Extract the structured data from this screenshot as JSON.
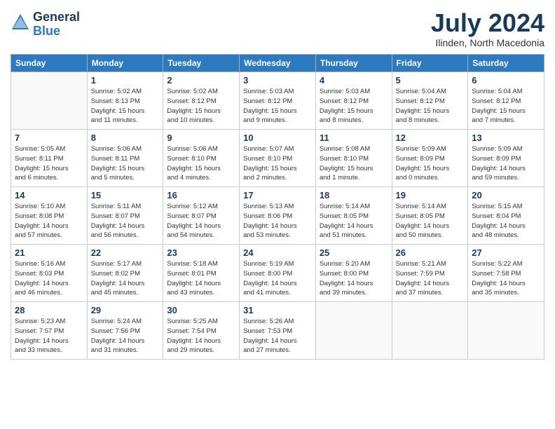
{
  "header": {
    "logo_line1": "General",
    "logo_line2": "Blue",
    "month_title": "July 2024",
    "location": "Ilinden, North Macedonia"
  },
  "weekdays": [
    "Sunday",
    "Monday",
    "Tuesday",
    "Wednesday",
    "Thursday",
    "Friday",
    "Saturday"
  ],
  "weeks": [
    [
      {
        "day": "",
        "info": ""
      },
      {
        "day": "1",
        "info": "Sunrise: 5:02 AM\nSunset: 8:13 PM\nDaylight: 15 hours\nand 11 minutes."
      },
      {
        "day": "2",
        "info": "Sunrise: 5:02 AM\nSunset: 8:12 PM\nDaylight: 15 hours\nand 10 minutes."
      },
      {
        "day": "3",
        "info": "Sunrise: 5:03 AM\nSunset: 8:12 PM\nDaylight: 15 hours\nand 9 minutes."
      },
      {
        "day": "4",
        "info": "Sunrise: 5:03 AM\nSunset: 8:12 PM\nDaylight: 15 hours\nand 8 minutes."
      },
      {
        "day": "5",
        "info": "Sunrise: 5:04 AM\nSunset: 8:12 PM\nDaylight: 15 hours\nand 8 minutes."
      },
      {
        "day": "6",
        "info": "Sunrise: 5:04 AM\nSunset: 8:12 PM\nDaylight: 15 hours\nand 7 minutes."
      }
    ],
    [
      {
        "day": "7",
        "info": "Sunrise: 5:05 AM\nSunset: 8:11 PM\nDaylight: 15 hours\nand 6 minutes."
      },
      {
        "day": "8",
        "info": "Sunrise: 5:06 AM\nSunset: 8:11 PM\nDaylight: 15 hours\nand 5 minutes."
      },
      {
        "day": "9",
        "info": "Sunrise: 5:06 AM\nSunset: 8:10 PM\nDaylight: 15 hours\nand 4 minutes."
      },
      {
        "day": "10",
        "info": "Sunrise: 5:07 AM\nSunset: 8:10 PM\nDaylight: 15 hours\nand 2 minutes."
      },
      {
        "day": "11",
        "info": "Sunrise: 5:08 AM\nSunset: 8:10 PM\nDaylight: 15 hours\nand 1 minute."
      },
      {
        "day": "12",
        "info": "Sunrise: 5:09 AM\nSunset: 8:09 PM\nDaylight: 15 hours\nand 0 minutes."
      },
      {
        "day": "13",
        "info": "Sunrise: 5:09 AM\nSunset: 8:09 PM\nDaylight: 14 hours\nand 59 minutes."
      }
    ],
    [
      {
        "day": "14",
        "info": "Sunrise: 5:10 AM\nSunset: 8:08 PM\nDaylight: 14 hours\nand 57 minutes."
      },
      {
        "day": "15",
        "info": "Sunrise: 5:11 AM\nSunset: 8:07 PM\nDaylight: 14 hours\nand 56 minutes."
      },
      {
        "day": "16",
        "info": "Sunrise: 5:12 AM\nSunset: 8:07 PM\nDaylight: 14 hours\nand 54 minutes."
      },
      {
        "day": "17",
        "info": "Sunrise: 5:13 AM\nSunset: 8:06 PM\nDaylight: 14 hours\nand 53 minutes."
      },
      {
        "day": "18",
        "info": "Sunrise: 5:14 AM\nSunset: 8:05 PM\nDaylight: 14 hours\nand 51 minutes."
      },
      {
        "day": "19",
        "info": "Sunrise: 5:14 AM\nSunset: 8:05 PM\nDaylight: 14 hours\nand 50 minutes."
      },
      {
        "day": "20",
        "info": "Sunrise: 5:15 AM\nSunset: 8:04 PM\nDaylight: 14 hours\nand 48 minutes."
      }
    ],
    [
      {
        "day": "21",
        "info": "Sunrise: 5:16 AM\nSunset: 8:03 PM\nDaylight: 14 hours\nand 46 minutes."
      },
      {
        "day": "22",
        "info": "Sunrise: 5:17 AM\nSunset: 8:02 PM\nDaylight: 14 hours\nand 45 minutes."
      },
      {
        "day": "23",
        "info": "Sunrise: 5:18 AM\nSunset: 8:01 PM\nDaylight: 14 hours\nand 43 minutes."
      },
      {
        "day": "24",
        "info": "Sunrise: 5:19 AM\nSunset: 8:00 PM\nDaylight: 14 hours\nand 41 minutes."
      },
      {
        "day": "25",
        "info": "Sunrise: 5:20 AM\nSunset: 8:00 PM\nDaylight: 14 hours\nand 39 minutes."
      },
      {
        "day": "26",
        "info": "Sunrise: 5:21 AM\nSunset: 7:59 PM\nDaylight: 14 hours\nand 37 minutes."
      },
      {
        "day": "27",
        "info": "Sunrise: 5:22 AM\nSunset: 7:58 PM\nDaylight: 14 hours\nand 35 minutes."
      }
    ],
    [
      {
        "day": "28",
        "info": "Sunrise: 5:23 AM\nSunset: 7:57 PM\nDaylight: 14 hours\nand 33 minutes."
      },
      {
        "day": "29",
        "info": "Sunrise: 5:24 AM\nSunset: 7:56 PM\nDaylight: 14 hours\nand 31 minutes."
      },
      {
        "day": "30",
        "info": "Sunrise: 5:25 AM\nSunset: 7:54 PM\nDaylight: 14 hours\nand 29 minutes."
      },
      {
        "day": "31",
        "info": "Sunrise: 5:26 AM\nSunset: 7:53 PM\nDaylight: 14 hours\nand 27 minutes."
      },
      {
        "day": "",
        "info": ""
      },
      {
        "day": "",
        "info": ""
      },
      {
        "day": "",
        "info": ""
      }
    ]
  ]
}
